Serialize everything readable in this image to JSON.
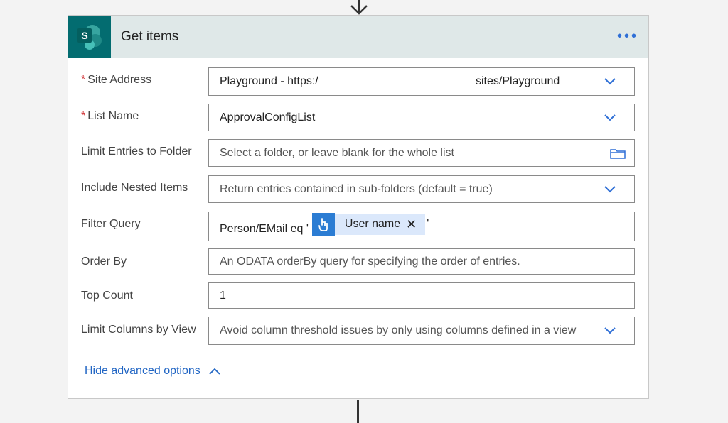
{
  "action": {
    "title": "Get items",
    "app_icon_letter": "S",
    "brand_color": "#036c70"
  },
  "fields": {
    "site_address": {
      "label": "Site Address",
      "value_left": "Playground - https:/",
      "value_right": "sites/Playground"
    },
    "list_name": {
      "label": "List Name",
      "value": "ApprovalConfigList"
    },
    "limit_folder": {
      "label": "Limit Entries to Folder",
      "placeholder": "Select a folder, or leave blank for the whole list"
    },
    "nested_items": {
      "label": "Include Nested Items",
      "placeholder": "Return entries contained in sub-folders (default = true)"
    },
    "filter_query": {
      "label": "Filter Query",
      "prefix": "Person/EMail eq '",
      "token": "User name",
      "suffix": "'"
    },
    "order_by": {
      "label": "Order By",
      "placeholder": "An ODATA orderBy query for specifying the order of entries."
    },
    "top_count": {
      "label": "Top Count",
      "value": "1"
    },
    "limit_columns": {
      "label": "Limit Columns by View",
      "placeholder": "Avoid column threshold issues by only using columns defined in a view"
    }
  },
  "required_mark": "*",
  "advanced_link": "Hide advanced options",
  "icons": [
    "arrow-down-icon",
    "sharepoint-icon",
    "more-icon",
    "chevron-down-icon",
    "folder-icon",
    "touch-icon",
    "close-icon",
    "chevron-up-icon"
  ]
}
